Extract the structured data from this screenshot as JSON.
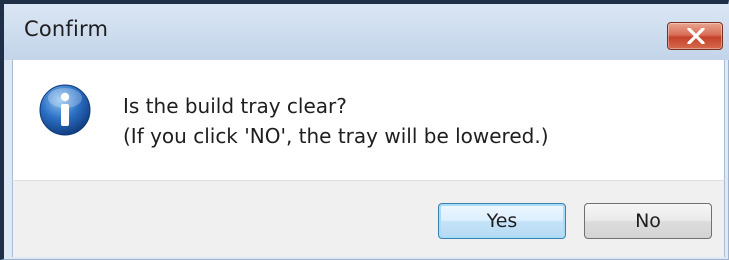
{
  "window": {
    "title": "Confirm",
    "close_icon": "close-icon"
  },
  "message": {
    "icon": "info-icon",
    "line1": "Is the build tray clear?",
    "line2": "(If you click 'NO', the tray will be lowered.)"
  },
  "buttons": {
    "yes_label": "Yes",
    "no_label": "No",
    "default": "Yes"
  },
  "colors": {
    "close_button": "#c4422a",
    "info_icon": "#2b6fc4",
    "default_button_border": "#3c7fb1"
  }
}
